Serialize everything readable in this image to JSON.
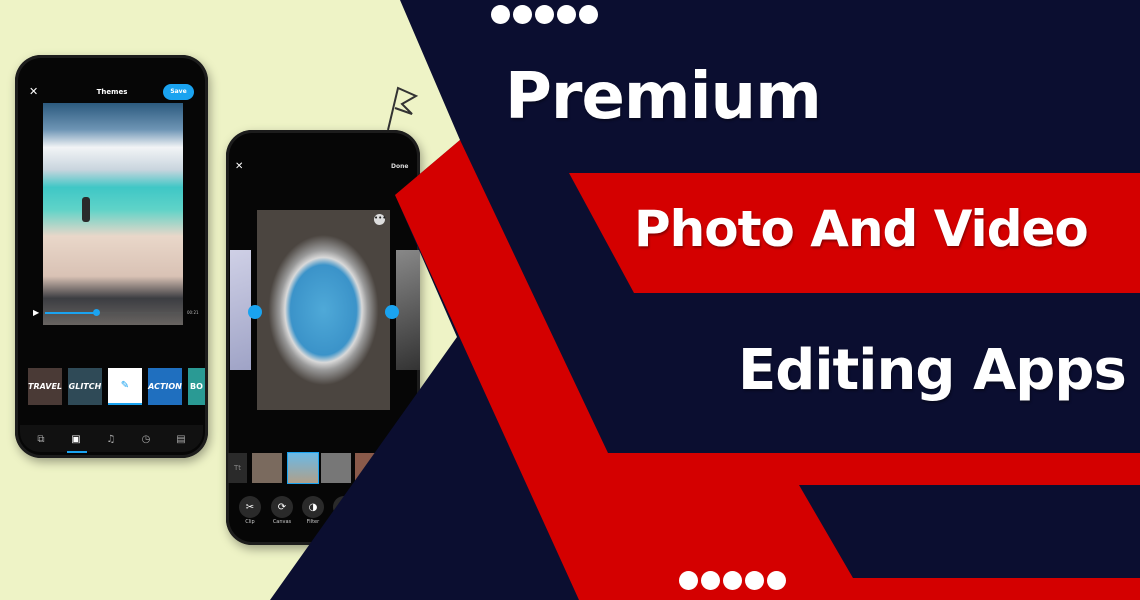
{
  "colors": {
    "background": "#eef3c6",
    "navy": "#0b0e30",
    "red": "#d40000",
    "accent_blue": "#1aa3f0",
    "text": "#ffffff"
  },
  "headline": {
    "line1": "Premium",
    "line2": "Photo And Video",
    "line3": "Editing Apps"
  },
  "phone_themes": {
    "close_icon": "close-icon",
    "title": "Themes",
    "save_label": "Save",
    "time": "00:21",
    "progress": 0.4,
    "themes": [
      "TRAVEL",
      "GLITCH",
      "",
      "ACTION",
      "BO"
    ],
    "tabs": [
      "layers-icon",
      "theme-icon",
      "music-icon",
      "timer-icon",
      "layout-icon"
    ],
    "active_tab": 1
  },
  "phone_editor": {
    "close_icon": "close-icon",
    "done_label": "Done",
    "filmstrip_text": "Tt",
    "tools": [
      {
        "label": "Clip",
        "icon": "scissors-icon"
      },
      {
        "label": "Canvas",
        "icon": "canvas-icon"
      },
      {
        "label": "Filter",
        "icon": "filter-icon"
      },
      {
        "label": "",
        "icon": "speed-icon"
      }
    ]
  }
}
